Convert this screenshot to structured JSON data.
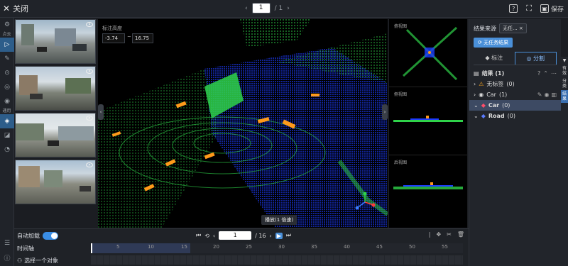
{
  "header": {
    "close_label": "关闭",
    "page_current": "1",
    "page_total": "/ 1",
    "save_label": "保存"
  },
  "left_tools": {
    "pointcloud_label": "点云",
    "general_label": "通用"
  },
  "view3d": {
    "height_label": "标注高度",
    "height_min": "-3.74",
    "height_sep": "~",
    "height_max": "16.75",
    "tooltip": "播放(1 倍速)"
  },
  "side_views": {
    "top": "俯视图",
    "side": "侧视图",
    "rear": "后视图"
  },
  "right_panel": {
    "source_label": "结果来源",
    "source_chip": "无任...",
    "no_task_button": "无任务结果",
    "tab_annotate": "标注",
    "tab_segment": "分割",
    "results_title": "结果 (1)",
    "items": [
      {
        "label": "无标签",
        "count": "(0)"
      },
      {
        "label": "Car",
        "count": "(1)"
      },
      {
        "label": "Car",
        "count": "(0)"
      },
      {
        "label": "Road",
        "count": "(0)"
      }
    ],
    "vtabs": [
      "有效",
      "分类",
      "结果"
    ]
  },
  "bottom": {
    "autoload_label": "自动加载",
    "frame_current": "1",
    "frame_total": "/ 16",
    "timeline_label": "时间轴",
    "select_object_label": "选择一个对象",
    "ticks": [
      "5",
      "10",
      "15",
      "20",
      "25",
      "30",
      "35",
      "40",
      "45",
      "50",
      "55"
    ]
  },
  "colors": {
    "accent": "#4a90d9",
    "panel_bg": "#22252b",
    "lidar_green": "#2fd34a",
    "lidar_blue": "#1530d8",
    "lidar_orange": "#ff9a1a"
  }
}
